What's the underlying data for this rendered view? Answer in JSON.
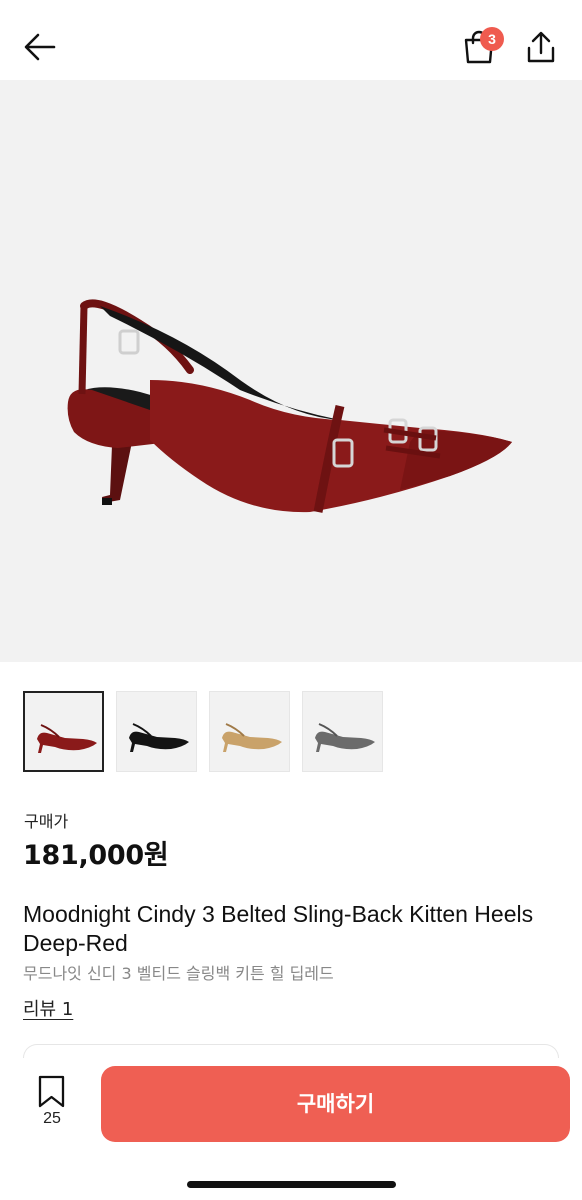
{
  "header": {
    "cart_badge_count": "3",
    "back_icon": "arrow-left-icon",
    "cart_icon": "shopping-bag-icon",
    "share_icon": "share-icon"
  },
  "gallery": {
    "main_image_alt": "Moodnight Cindy 3 Belted Sling-Back Kitten Heels Deep-Red",
    "thumbnails": [
      {
        "color": "#8a1a1a",
        "selected": true
      },
      {
        "color": "#141414",
        "selected": false
      },
      {
        "color": "#c9a26a",
        "selected": false
      },
      {
        "color": "#6b6b6b",
        "selected": false
      }
    ]
  },
  "product": {
    "price_label": "구매가",
    "price": "181,000원",
    "title": "Moodnight Cindy 3 Belted Sling-Back Kitten Heels Deep-Red",
    "subtitle": "무드나잇 신디 3 벨티드 슬링백 키튼 힐 딥레드",
    "review_link": "리뷰 1"
  },
  "bottom_bar": {
    "wishlist_icon": "bookmark-icon",
    "wishlist_count": "25",
    "buy_label": "구매하기"
  },
  "colors": {
    "accent": "#ef5f53",
    "shoe_main": "#8a1a1a"
  }
}
